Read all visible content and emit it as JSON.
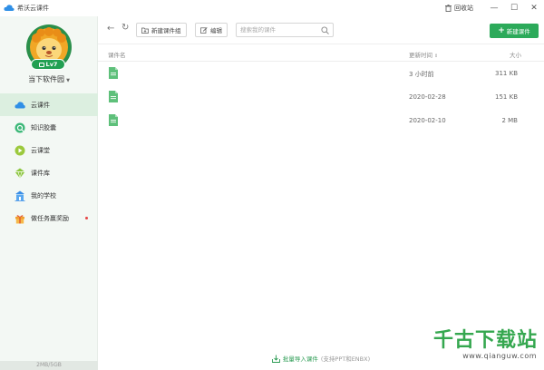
{
  "window": {
    "title": "希沃云课件",
    "recycle_label": "回收站",
    "minimize": "—",
    "maximize": "☐",
    "close": "✕"
  },
  "sidebar": {
    "level": "Lv7",
    "garden_name": "当下软件园",
    "items": [
      {
        "label": "云课件",
        "icon": "cloud-icon",
        "active": true
      },
      {
        "label": "知识胶囊",
        "icon": "capsule-icon"
      },
      {
        "label": "云课堂",
        "icon": "classroom-icon"
      },
      {
        "label": "课件库",
        "icon": "library-icon"
      },
      {
        "label": "我的学校",
        "icon": "school-icon"
      },
      {
        "label": "做任务赢奖励",
        "icon": "gift-icon",
        "badge": true
      }
    ],
    "storage": "2MB/5GB"
  },
  "toolbar": {
    "back": "←",
    "refresh": "↻",
    "new_group": "新建课件组",
    "edit": "编辑",
    "search_placeholder": "搜索我的课件",
    "new_courseware": "新建课件"
  },
  "table": {
    "columns": {
      "name": "课件名",
      "date": "更新时间",
      "size": "大小"
    },
    "rows": [
      {
        "name": "",
        "date": "3 小时前",
        "size": "311 KB"
      },
      {
        "name": "",
        "date": "2020-02-28",
        "size": "151 KB"
      },
      {
        "name": "",
        "date": "2020-02-10",
        "size": "2 MB"
      }
    ]
  },
  "import": {
    "link": "批量导入课件",
    "hint": "(支持PPT和ENBX)"
  },
  "watermark": {
    "title": "千古下载站",
    "url": "www.qianguw.com"
  },
  "colors": {
    "brand_green": "#2caa5a",
    "sidebar_bg": "#f3f8f4",
    "active_bg": "#dcefe0",
    "file_green": "#5ec07a"
  }
}
